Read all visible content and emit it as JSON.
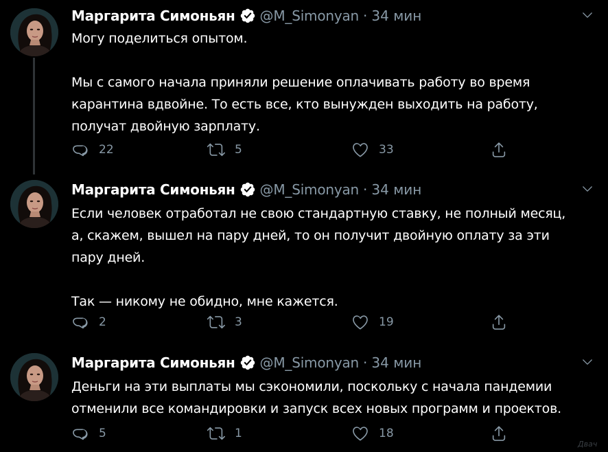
{
  "colors": {
    "background": "#000000",
    "text": "#ffffff",
    "muted": "#8899a6",
    "verified": "#ffffff",
    "thread_line": "#2f3336"
  },
  "tweets": [
    {
      "author_name": "Маргарита Симоньян",
      "handle": "@M_Simonyan",
      "separator": "·",
      "time": "34 мин",
      "paragraphs": [
        "Могу поделиться опытом.",
        "Мы с самого начала приняли решение оплачивать работу во время\nкарантина вдвойне. То есть все, кто вынужден выходить на работу,\nполучат двойную зарплату."
      ],
      "replies": "22",
      "retweets": "5",
      "likes": "33"
    },
    {
      "author_name": "Маргарита Симоньян",
      "handle": "@M_Simonyan",
      "separator": "·",
      "time": "34 мин",
      "paragraphs": [
        "Если человек отработал не свою стандартную ставку, не полный месяц,\nа, скажем, вышел на пару дней, то он получит двойную оплату за эти\nпару дней.",
        "Так — никому не обидно, мне кажется."
      ],
      "replies": "2",
      "retweets": "3",
      "likes": "19"
    },
    {
      "author_name": "Маргарита Симоньян",
      "handle": "@M_Simonyan",
      "separator": "·",
      "time": "34 мин",
      "paragraphs": [
        "Деньги на эти выплаты мы сэкономили, поскольку с начала пандемии\nотменили все командировки и запуск всех новых программ и проектов."
      ],
      "replies": "5",
      "retweets": "1",
      "likes": "18"
    }
  ],
  "icons": {
    "avatar": "avatar-photo",
    "verified": "verified-badge-icon",
    "more": "chevron-down-icon",
    "reply": "reply-icon",
    "retweet": "retweet-icon",
    "like": "heart-icon",
    "share": "share-icon"
  },
  "watermark": "Двач"
}
